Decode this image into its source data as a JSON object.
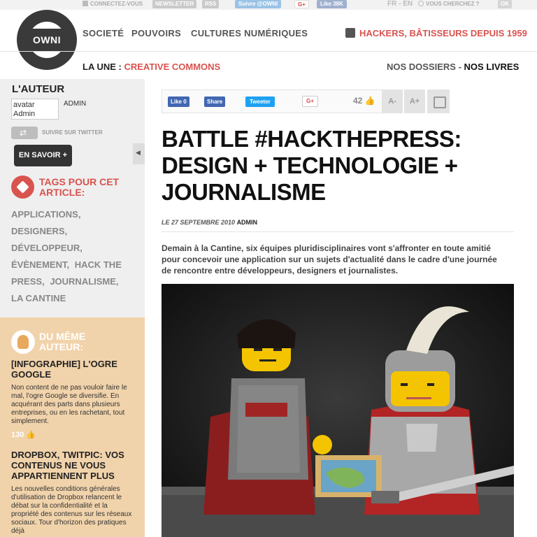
{
  "topbar": {
    "connect": "CONNECTEZ-VOUS",
    "newsletter": "NEWSLETTER",
    "rss": "RSS",
    "twitter": "Suivre @OWNI",
    "gplus": "G+",
    "facebook": "Like 38K",
    "lang": "FR - EN",
    "search_placeholder": "VOUS CHERCHEZ ?",
    "search_button": "OK"
  },
  "header": {
    "logo": "OWNI",
    "nav": [
      "SOCIETÉ",
      "POUVOIRS",
      "CULTURES NUMÉRIQUES"
    ],
    "hackers": "HACKERS, BÂTISSEURS DEPUIS 1959",
    "laune_prefix": "LA UNE :",
    "laune_link": "CREATIVE COMMONS",
    "dossiers": "NOS DOSSIERS",
    "separator": " - ",
    "livres": "NOS LIVRES"
  },
  "sidebar": {
    "auteur_title": "L'AUTEUR",
    "avatar_alt": "avatar Admin",
    "author_name": "ADMIN",
    "follow_label": "SUIVRE SUR TWITTER",
    "en_savoir": "EN SAVOIR +",
    "tags_title": "TAGS POUR CET ARTICLE:",
    "tags": [
      "APPLICATIONS,",
      "DESIGNERS,",
      "DÉVELOPPEUR,",
      "ÉVÈNEMENT,",
      "HACK THE PRESS,",
      "JOURNALISME,",
      "LA CANTINE"
    ],
    "meme_title": "DU MÊME AUTEUR:",
    "articles": [
      {
        "title": "[INFOGRAPHIE] L'OGRE GOOGLE",
        "desc": "Non content de ne pas vouloir faire le mal, l'ogre Google se diversifie. En acquérant des parts dans plusieurs entreprises, ou en les rachetant, tout simplement.",
        "score": "130"
      },
      {
        "title": "DROPBOX, TWITPIC: VOS CONTENUS NE VOUS APPARTIENNENT PLUS",
        "desc": "Les nouvelles conditions générales d'utilisation de Dropbox relancent le débat sur la confidentialité et la propriété des contenus sur les réseaux sociaux. Tour d'horizon des pratiques déjà",
        "score": ""
      }
    ]
  },
  "share": {
    "fb_like": "Like 0",
    "fb_share": "Share",
    "tweet": "Tweeter",
    "gplus": "G+",
    "count": "42",
    "a_minus": "A-",
    "a_plus": "A+"
  },
  "article": {
    "headline": "BATTLE #HACKTHEPRESS: DESIGN + TECHNOLOGIE + JOURNALISME",
    "date": "LE 27 SEPTEMBRE 2010",
    "author": "ADMIN",
    "lede": "Demain à la Cantine, six équipes pluridisciplinaires vont s'affronter en toute amitié pour concevoir une application sur un sujets d'actualité dans le cadre d'une journée de rencontre entre développeurs, designers et journalistes."
  },
  "colors": {
    "accent": "#d9534f",
    "sidebar_bg": "#efefef",
    "meme_bg": "#f1d3ab"
  }
}
